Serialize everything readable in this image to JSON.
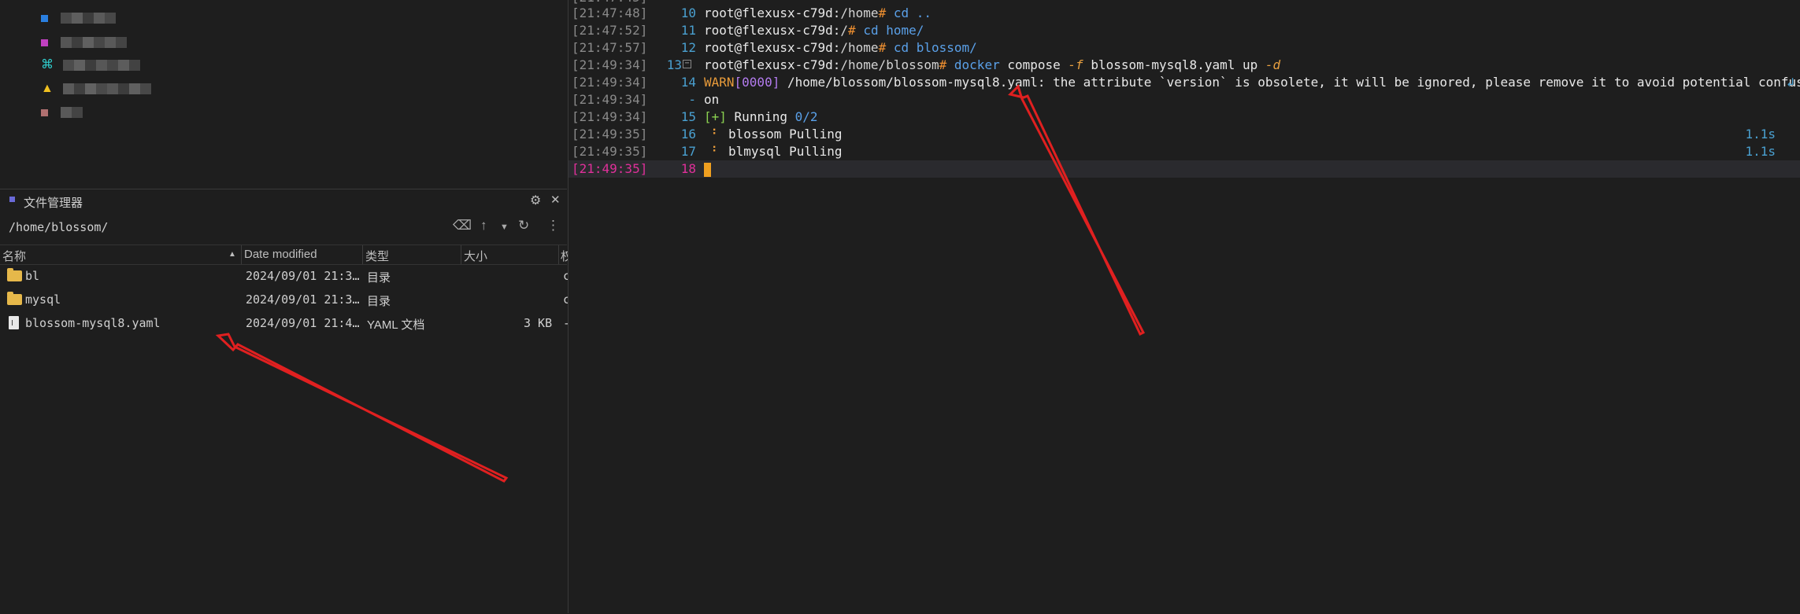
{
  "colors": {
    "accent": "#4aa0d0",
    "arrow": "#e02020",
    "folder": "#e6b84a"
  },
  "file_manager": {
    "title": "文件管理器",
    "path": "/home/blossom/",
    "columns": {
      "name": "名称",
      "modified": "Date modified",
      "type": "类型",
      "size": "大小",
      "extra": "权"
    },
    "rows": [
      {
        "icon": "folder-icon",
        "name": "bl",
        "modified": "2024/09/01 21:3…",
        "type": "目录",
        "size": "",
        "tail": "c"
      },
      {
        "icon": "folder-icon",
        "name": "mysql",
        "modified": "2024/09/01 21:3…",
        "type": "目录",
        "size": "",
        "tail": "c"
      },
      {
        "icon": "file-icon",
        "name": "blossom-mysql8.yaml",
        "modified": "2024/09/01 21:4…",
        "type": "YAML 文档",
        "size": "3 KB",
        "tail": "-"
      }
    ]
  },
  "terminal": {
    "lines": [
      {
        "ts": "[21:47:48]",
        "ln": "10",
        "user": "root@flexusx-c79d:",
        "dir": "/home",
        "hash": "#",
        "cmd": "cd ..",
        "rest": ""
      },
      {
        "ts": "[21:47:52]",
        "ln": "11",
        "user": "root@flexusx-c79d:",
        "dir": "/",
        "hash": "#",
        "cmd": "cd home/",
        "rest": ""
      },
      {
        "ts": "[21:47:57]",
        "ln": "12",
        "user": "root@flexusx-c79d:",
        "dir": "/home",
        "hash": "#",
        "cmd": "cd blossom/",
        "rest": ""
      },
      {
        "ts": "[21:49:34]",
        "ln": "13",
        "user": "root@flexusx-c79d:",
        "dir": "/home/blossom",
        "hash": "#",
        "cmd": "docker",
        "rest": "compose"
      }
    ],
    "line13_opt": "-f",
    "line13_file": "blossom-mysql8.yaml up",
    "line13_opt2": "-d",
    "warn": {
      "ts": "[21:49:34]",
      "ln": "14",
      "label": "WARN",
      "code": "[0000]",
      "text": "/home/blossom/blossom-mysql8.yaml: the attribute `version` is obsolete, it will be ignored, please remove it to avoid potential confusi"
    },
    "wrap": {
      "ts": "[21:49:34]",
      "ln": "-",
      "text": "on"
    },
    "running": {
      "ts": "[21:49:34]",
      "ln": "15",
      "bracket": "[+]",
      "label": "Running",
      "count": "0/2"
    },
    "pulls": [
      {
        "ts": "[21:49:35]",
        "ln": "16",
        "text": "blossom Pulling",
        "dur": "1.1s"
      },
      {
        "ts": "[21:49:35]",
        "ln": "17",
        "text": "blmysql Pulling",
        "dur": "1.1s"
      }
    ],
    "current": {
      "ts": "[21:49:35]",
      "ln": "18"
    }
  }
}
